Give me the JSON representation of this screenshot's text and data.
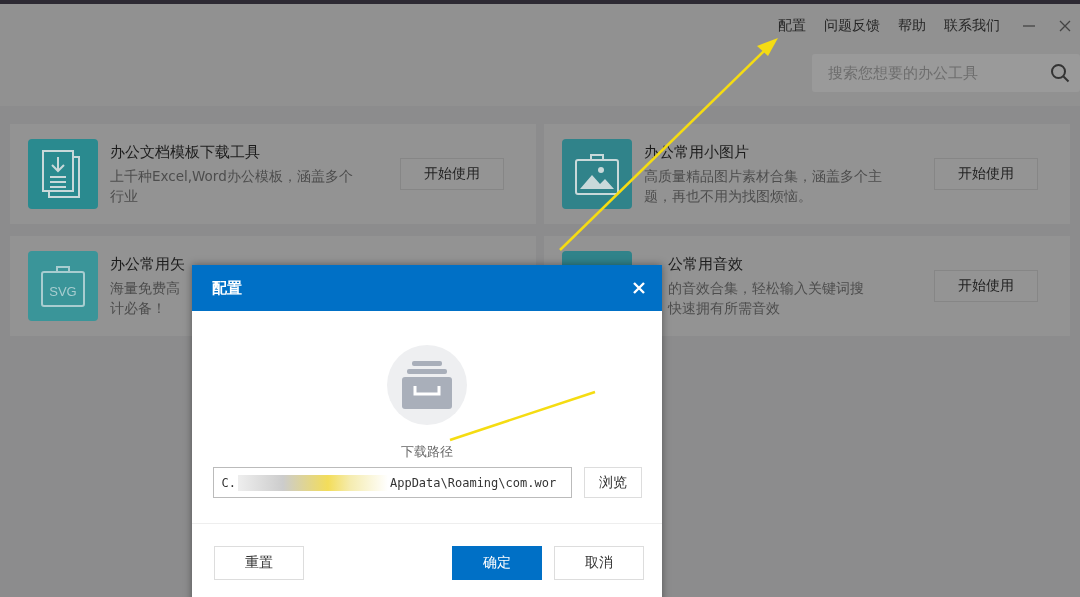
{
  "top_links": [
    "配置",
    "问题反馈",
    "帮助",
    "联系我们"
  ],
  "search": {
    "placeholder": "搜索您想要的办公工具"
  },
  "tools": [
    {
      "kind": "document",
      "title": "办公文档模板下载工具",
      "description": [
        "上千种Excel,Word办公模板，涵盖多个",
        "行业"
      ],
      "button": "开始使用"
    },
    {
      "kind": "image",
      "title": "办公常用小图片",
      "description": [
        "高质量精品图片素材合集，涵盖多个主",
        "题，再也不用为找图烦恼。"
      ],
      "button": "开始使用"
    },
    {
      "kind": "svg",
      "icon_text": "SVG",
      "title": "办公常用矢",
      "description": [
        "海量免费高",
        "计必备！"
      ]
    },
    {
      "kind": "audio",
      "title": "公常用音效",
      "description": [
        "的音效合集，轻松输入关键词搜",
        "快速拥有所需音效"
      ],
      "button": "开始使用"
    }
  ],
  "dialog": {
    "title": "配置",
    "label": "下载路径",
    "path_start": "C.",
    "path_end": "AppData\\Roaming\\com.wor",
    "browse": "浏览",
    "reset": "重置",
    "ok": "确定",
    "cancel": "取消"
  }
}
